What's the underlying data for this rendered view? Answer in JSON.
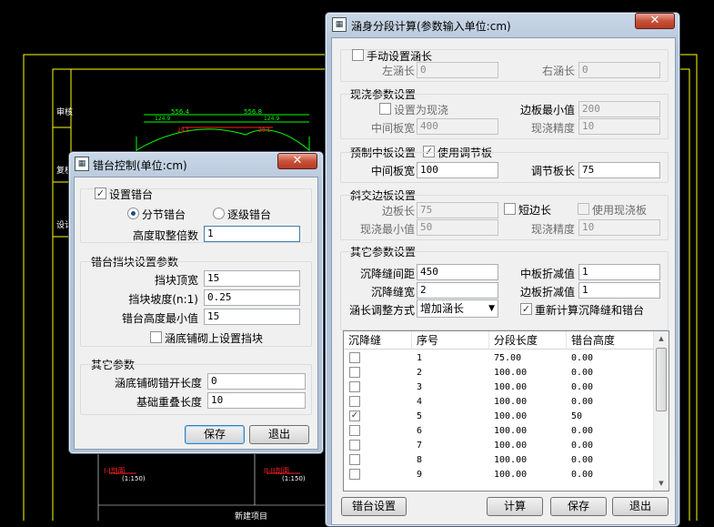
{
  "cad": {
    "dim_labels": [
      "556.4",
      "556.8",
      "124.9",
      "124.9",
      "29.1",
      "29.1"
    ],
    "side_labels": [
      "审核",
      "复核",
      "设计"
    ],
    "red_labels": [
      "I-I剖面",
      "II-II剖面"
    ],
    "sub_labels": [
      "(1:150)",
      "(1:150)"
    ],
    "footer": "新建项目"
  },
  "colors": {
    "cad_yellow": "#ffff00",
    "cad_green": "#00ff00",
    "cad_red": "#ff2020"
  },
  "abutment": {
    "title": "错台控制(单位:cm)",
    "close_icon": "close-icon",
    "set_checkbox_label": "设置错台",
    "radio_sections": "分节错台",
    "radio_step": "逐级错台",
    "height_multiple_label": "高度取整倍数",
    "height_multiple_value": "1",
    "block_group": "错台挡块设置参数",
    "block_top_width_label": "挡块顶宽",
    "block_top_width_value": "15",
    "block_slope_label": "挡块坡度(n:1)",
    "block_slope_value": "0.25",
    "min_height_label": "错台高度最小值",
    "min_height_value": "15",
    "paving_block_label": "涵底铺砌上设置挡块",
    "other_group": "其它参数",
    "paving_length_label": "涵底铺砌错开长度",
    "paving_length_value": "0",
    "overlap_label": "基础重叠长度",
    "overlap_value": "10",
    "save": "保存",
    "exit": "退出"
  },
  "segment": {
    "title": "涵身分段计算(参数输入单位:cm)",
    "close_icon": "close-icon",
    "manual_length_label": "手动设置涵长",
    "left_len_label": "左涵长",
    "left_len_value": "0",
    "right_len_label": "右涵长",
    "right_len_value": "0",
    "cast_group": "现浇参数设置",
    "set_cast_label": "设置为现浇",
    "edge_min_label": "边板最小值",
    "edge_min_value": "200",
    "mid_width_label": "中间板宽",
    "mid_width_value": "400",
    "cast_precision_label": "现浇精度",
    "cast_precision_value": "10",
    "precast_group": "预制中板设置",
    "use_adjust_label": "使用调节板",
    "precast_mid_label": "中间板宽",
    "precast_mid_value": "100",
    "adjust_len_label": "调节板长",
    "adjust_len_value": "75",
    "skew_group": "斜交边板设置",
    "edge_len_label": "边板长",
    "edge_len_value": "75",
    "short_edge_label": "短边长",
    "use_cast_label": "使用现浇板",
    "cast_min_label": "现浇最小值",
    "cast_min_value": "50",
    "skew_precision_label": "现浇精度",
    "skew_precision_value": "10",
    "other_group": "其它参数设置",
    "settle_spacing_label": "沉降缝间距",
    "settle_spacing_value": "450",
    "mid_reduce_label": "中板折减值",
    "mid_reduce_value": "1",
    "settle_width_label": "沉降缝宽",
    "settle_width_value": "2",
    "edge_reduce_label": "边板折减值",
    "edge_reduce_value": "1",
    "adjust_mode_label": "涵长调整方式",
    "adjust_mode_value": "增加涵长",
    "recalc_label": "重新计算沉降缝和错台",
    "columns": [
      "沉降缝",
      "序号",
      "分段长度",
      "错台高度"
    ],
    "rows": [
      {
        "checked": false,
        "no": "1",
        "len": "75.00",
        "h": "0.00"
      },
      {
        "checked": false,
        "no": "2",
        "len": "100.00",
        "h": "0.00"
      },
      {
        "checked": false,
        "no": "3",
        "len": "100.00",
        "h": "0.00"
      },
      {
        "checked": false,
        "no": "4",
        "len": "100.00",
        "h": "0.00"
      },
      {
        "checked": true,
        "no": "5",
        "len": "100.00",
        "h": "50"
      },
      {
        "checked": false,
        "no": "6",
        "len": "100.00",
        "h": "0.00"
      },
      {
        "checked": false,
        "no": "7",
        "len": "100.00",
        "h": "0.00"
      },
      {
        "checked": false,
        "no": "8",
        "len": "100.00",
        "h": "0.00"
      },
      {
        "checked": false,
        "no": "9",
        "len": "100.00",
        "h": "0.00"
      }
    ],
    "btn_abutment": "错台设置",
    "btn_calc": "计算",
    "btn_save": "保存",
    "btn_exit": "退出"
  }
}
